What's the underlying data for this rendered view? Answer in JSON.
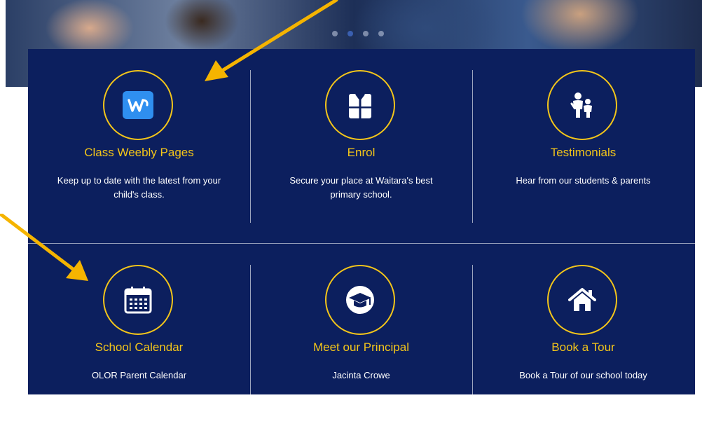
{
  "hero": {
    "slide_count": 4,
    "active_slide": 1
  },
  "cards": [
    {
      "title": "Class Weebly Pages",
      "description": "Keep up to date with the latest from your child's class.",
      "icon": "weebly-icon"
    },
    {
      "title": "Enrol",
      "description": "Secure your place at Waitara's best primary school.",
      "icon": "uniform-icon"
    },
    {
      "title": "Testimonials",
      "description": "Hear from our students & parents",
      "icon": "parent-child-icon"
    },
    {
      "title": "School Calendar",
      "description": "OLOR Parent Calendar",
      "icon": "calendar-icon"
    },
    {
      "title": "Meet our Principal",
      "description": "Jacinta Crowe",
      "icon": "graduation-cap-icon"
    },
    {
      "title": "Book a Tour",
      "description": "Book a Tour of our school today",
      "icon": "home-icon"
    }
  ],
  "colors": {
    "panel": "#0c1f5e",
    "accent": "#f3c51a",
    "annotation_arrow": "#f5b400",
    "weebly": "#2f8ff0"
  }
}
